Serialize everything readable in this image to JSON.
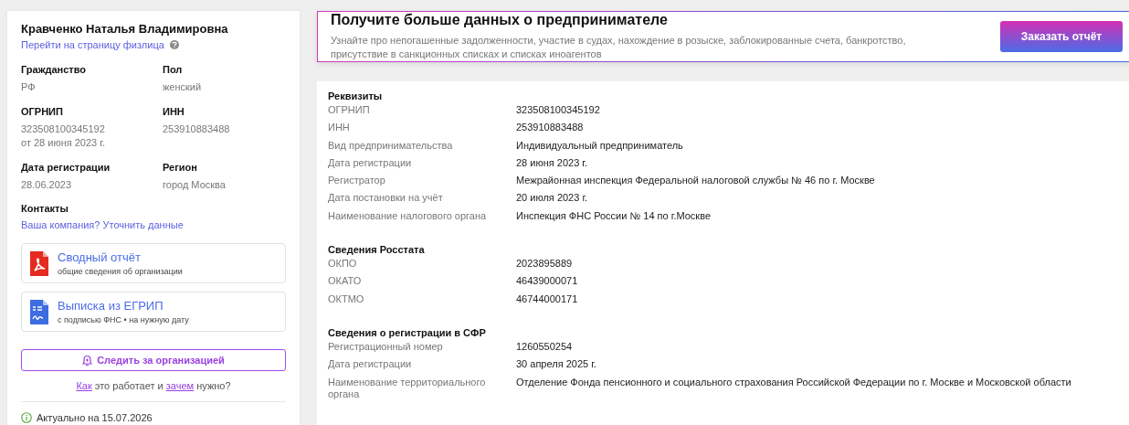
{
  "person": {
    "name": "Кравченко Наталья Владимировна",
    "profile_link": "Перейти на страницу физлица",
    "fields": [
      {
        "label": "Гражданство",
        "values": [
          "РФ"
        ]
      },
      {
        "label": "Пол",
        "values": [
          "женский"
        ]
      },
      {
        "label": "ОГРНИП",
        "values": [
          "323508100345192",
          "от 28 июня 2023 г."
        ]
      },
      {
        "label": "ИНН",
        "values": [
          "253910883488"
        ]
      },
      {
        "label": "Дата регистрации",
        "values": [
          "28.06.2023"
        ]
      },
      {
        "label": "Регион",
        "values": [
          "город Москва"
        ]
      }
    ],
    "contacts": {
      "label": "Контакты",
      "link": "Ваша компания? Уточнить данные"
    },
    "documents": [
      {
        "kind": "pdf",
        "title": "Сводный отчёт",
        "subtitle": "общие сведения об организации"
      },
      {
        "kind": "signed",
        "title": "Выписка из ЕГРИП",
        "subtitle": "с подписью ФНС • на нужную дату"
      }
    ],
    "follow_button": "Следить за организацией",
    "help": [
      {
        "kind": "link",
        "text": "Как"
      },
      {
        "kind": "text",
        "text": " это работает и "
      },
      {
        "kind": "link",
        "text": "зачем"
      },
      {
        "kind": "text",
        "text": " нужно?"
      }
    ],
    "updated": "Актуально на 15.07.2026"
  },
  "promo": {
    "title": "Получите больше данных о предпринимателе",
    "text": "Узнайте про непогашенные задолженности, участие в судах, нахождение в розыске, заблокированные счета, банкротство, присутствие в санкционных списках и списках иноагентов",
    "button": "Заказать отчёт"
  },
  "sections": [
    {
      "title": "Реквизиты",
      "rows": [
        {
          "label": "ОГРНИП",
          "value": "323508100345192"
        },
        {
          "label": "ИНН",
          "value": "253910883488"
        },
        {
          "label": "Вид предпринимательства",
          "value": "Индивидуальный предприниматель"
        },
        {
          "label": "Дата регистрации",
          "value": "28 июня 2023 г."
        },
        {
          "label": "Регистратор",
          "value": "Межрайонная инспекция Федеральной налоговой службы № 46 по г. Москве"
        },
        {
          "label": "Дата постановки на учёт",
          "value": "20 июля 2023 г."
        },
        {
          "label": "Наименование налогового органа",
          "value": "Инспекция ФНС России № 14 по г.Москве"
        }
      ]
    },
    {
      "title": "Сведения Росстата",
      "rows": [
        {
          "label": "ОКПО",
          "value": "2023895889"
        },
        {
          "label": "ОКАТО",
          "value": "46439000071"
        },
        {
          "label": "ОКТМО",
          "value": "46744000171"
        }
      ]
    },
    {
      "title": "Сведения о регистрации в СФР",
      "rows": [
        {
          "label": "Регистрационный номер",
          "value": "1260550254"
        },
        {
          "label": "Дата регистрации",
          "value": "30 апреля 2025 г."
        },
        {
          "label": "Наименование территориального органа",
          "value": "Отделение Фонда пенсионного и социального страхования Российской Федерации по г. Москве и Московской области"
        }
      ]
    }
  ]
}
